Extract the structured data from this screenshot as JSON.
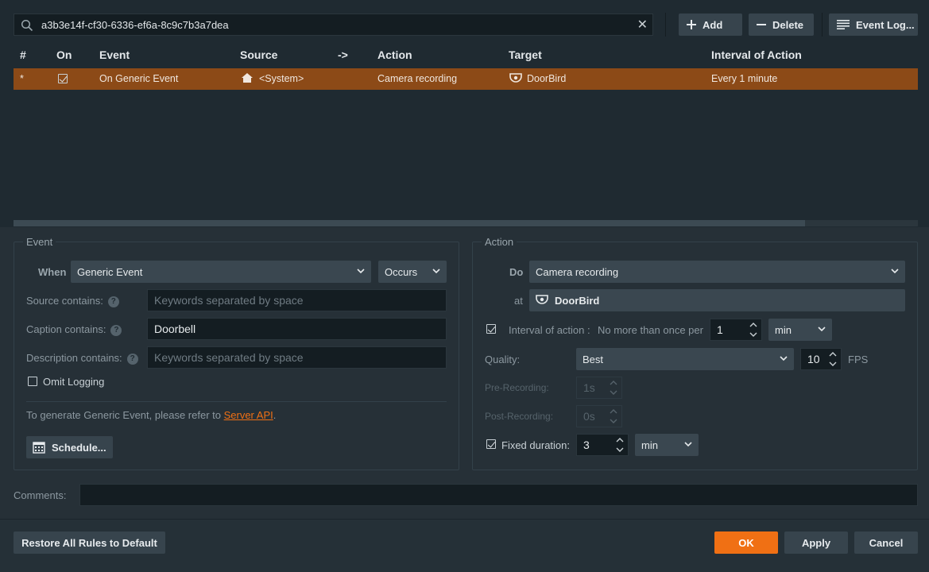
{
  "search": {
    "value": "a3b3e14f-cf30-6336-ef6a-8c9c7b3a7dea"
  },
  "toolbar": {
    "add_label": "Add",
    "delete_label": "Delete",
    "event_log_label": "Event Log..."
  },
  "table": {
    "columns": [
      "#",
      "On",
      "Event",
      "Source",
      "->",
      "Action",
      "Target",
      "Interval of Action"
    ],
    "rows": [
      {
        "num": "*",
        "on": true,
        "event": "On Generic Event",
        "source": "<System>",
        "action": "Camera recording",
        "target": "DoorBird",
        "interval": "Every 1 minute"
      }
    ]
  },
  "event": {
    "title": "Event",
    "when_label": "When",
    "when_value": "Generic Event",
    "occurs_value": "Occurs",
    "source_label": "Source contains:",
    "source_placeholder": "Keywords separated by space",
    "caption_label": "Caption contains:",
    "caption_value": "Doorbell",
    "description_label": "Description contains:",
    "description_placeholder": "Keywords separated by space",
    "omit_logging_label": "Omit Logging",
    "omit_logging_checked": false,
    "info_prefix": "To generate Generic Event, please refer to ",
    "info_link": "Server API",
    "info_suffix": ".",
    "schedule_label": "Schedule..."
  },
  "action": {
    "title": "Action",
    "do_label": "Do",
    "do_value": "Camera recording",
    "at_label": "at",
    "at_value": "DoorBird",
    "interval_label": "Interval of action :",
    "interval_checked": true,
    "no_more_label": "No more than once per",
    "interval_value": "1",
    "interval_unit": "min",
    "quality_label": "Quality:",
    "quality_value": "Best",
    "fps_value": "10",
    "fps_label": "FPS",
    "pre_label": "Pre-Recording:",
    "pre_value": "1s",
    "post_label": "Post-Recording:",
    "post_value": "0s",
    "fixed_label": "Fixed duration:",
    "fixed_checked": true,
    "fixed_value": "3",
    "fixed_unit": "min"
  },
  "comments": {
    "label": "Comments:",
    "value": ""
  },
  "footer": {
    "restore_label": "Restore All Rules to Default",
    "ok_label": "OK",
    "apply_label": "Apply",
    "cancel_label": "Cancel"
  },
  "colors": {
    "accent": "#f07014",
    "selected_row": "#8c4a17",
    "link": "#f07014"
  }
}
